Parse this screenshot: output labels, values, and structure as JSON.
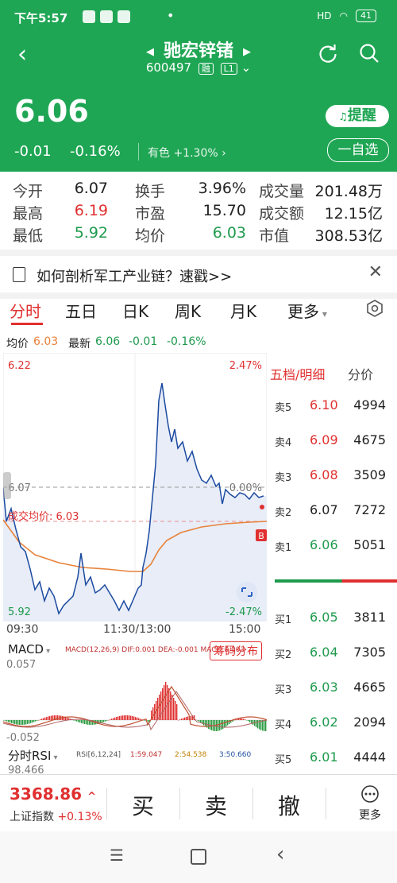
{
  "status_bar": {
    "time": "下午5:57",
    "signal": "HD",
    "battery": "41"
  },
  "header": {
    "name": "驰宏锌锗",
    "code": "600497",
    "tag1": "融",
    "tag2": "L1"
  },
  "quote": {
    "price": "6.06",
    "change": "-0.01",
    "change_pct": "-0.16%",
    "industry": "有色",
    "industry_change": "+1.30%",
    "remind_label": "提醒",
    "watch_label": "一自选"
  },
  "stats": [
    [
      {
        "label": "今开",
        "value": "6.07",
        "color": "dark"
      },
      {
        "label": "换手",
        "value": "3.96%",
        "color": "dark"
      },
      {
        "label": "成交量",
        "value": "201.48万",
        "color": "dark"
      }
    ],
    [
      {
        "label": "最高",
        "value": "6.19",
        "color": "red"
      },
      {
        "label": "市盈",
        "value": "15.70",
        "color": "dark"
      },
      {
        "label": "成交额",
        "value": "12.15亿",
        "color": "dark"
      }
    ],
    [
      {
        "label": "最低",
        "value": "5.92",
        "color": "green"
      },
      {
        "label": "均价",
        "value": "6.03",
        "color": "green"
      },
      {
        "label": "市值",
        "value": "308.53亿",
        "color": "dark"
      }
    ]
  ],
  "news": {
    "text": "如何剖析军工产业链？速戳>>"
  },
  "tabs": [
    "分时",
    "五日",
    "日K",
    "周K",
    "月K",
    "更多"
  ],
  "avg_line": {
    "avg_label": "均价",
    "avg_value": "6.03",
    "latest_label": "最新",
    "latest_value": "6.06",
    "latest_change": "-0.01",
    "latest_pct": "-0.16%"
  },
  "chart": {
    "price_max": "6.22",
    "price_min": "5.92",
    "pct_max": "2.47%",
    "pct_min": "-2.47%",
    "prev_close": "6.07",
    "zero_pct": "0.00%",
    "avg_label": "成交均价: 6.03",
    "b_marker": "B",
    "x_ticks": [
      "09:30",
      "11:30/13:00",
      "15:00"
    ]
  },
  "macd": {
    "selector": "MACD",
    "params": "MACD(12,26,9) DIF:0.001 DEA:-0.001 MACD:0.003",
    "top_value": "0.057",
    "bottom_value": "-0.052",
    "button": "筹码分布"
  },
  "rsi": {
    "selector": "分时RSI",
    "params": [
      "RSI[6,12,24]",
      "1:59.047",
      "2:54.538",
      "3:50.660"
    ],
    "top_value": "98.466"
  },
  "orderbook": {
    "header_left": "五档/明细",
    "header_right": "分价",
    "asks": [
      {
        "label": "卖5",
        "price": "6.10",
        "vol": "4994",
        "color": "red"
      },
      {
        "label": "卖4",
        "price": "6.09",
        "vol": "4675",
        "color": "red"
      },
      {
        "label": "卖3",
        "price": "6.08",
        "vol": "3509",
        "color": "red"
      },
      {
        "label": "卖2",
        "price": "6.07",
        "vol": "7272",
        "color": "dark"
      },
      {
        "label": "卖1",
        "price": "6.06",
        "vol": "5051",
        "color": "green"
      }
    ],
    "bids": [
      {
        "label": "买1",
        "price": "6.05",
        "vol": "3811",
        "color": "green"
      },
      {
        "label": "买2",
        "price": "6.04",
        "vol": "7305",
        "color": "green"
      },
      {
        "label": "买3",
        "price": "6.03",
        "vol": "4665",
        "color": "green"
      },
      {
        "label": "买4",
        "price": "6.02",
        "vol": "2094",
        "color": "green"
      },
      {
        "label": "买5",
        "price": "6.01",
        "vol": "4444",
        "color": "green"
      }
    ]
  },
  "bottom": {
    "index_value": "3368.86",
    "index_name": "上证指数",
    "index_change": "+0.13%",
    "buy": "买",
    "sell": "卖",
    "cancel": "撤",
    "more": "更多"
  },
  "colors": {
    "brand_green": "#1fa654",
    "up_red": "#e03030",
    "down_green": "#1e9a4d",
    "price_line": "#1b4aa0",
    "avg_line": "#e8823a"
  }
}
